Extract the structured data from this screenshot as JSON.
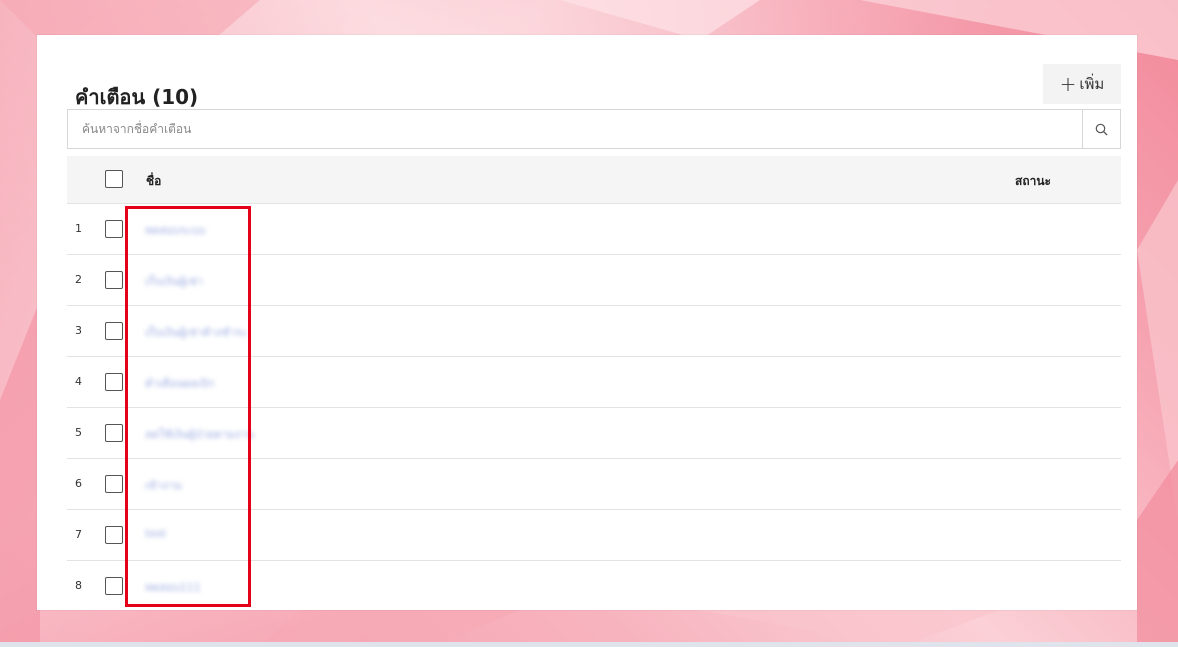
{
  "header": {
    "title": "คำเตือน (10)",
    "add_label": "เพิ่ม"
  },
  "search": {
    "placeholder": "ค้นหาจากชื่อคำเตือน"
  },
  "table": {
    "columns": {
      "name": "ชื่อ",
      "status": "สถานะ"
    },
    "rows": [
      {
        "num": "1",
        "name": "ทดสอบระบบ"
      },
      {
        "num": "2",
        "name": "เก็บเงินผู้เช่า"
      },
      {
        "num": "3",
        "name": "เก็บเงินผู้เช่าค้างชำระ"
      },
      {
        "num": "4",
        "name": "คำเตือนผลเบิก"
      },
      {
        "num": "5",
        "name": "ลดใช้เงินผู้ป่วยตามงาน"
      },
      {
        "num": "6",
        "name": "เข้างาน"
      },
      {
        "num": "7",
        "name": "test"
      },
      {
        "num": "8",
        "name": "ทดสอบ111"
      }
    ]
  },
  "colors": {
    "highlight": "#e4001b",
    "link": "#4a66c8"
  }
}
